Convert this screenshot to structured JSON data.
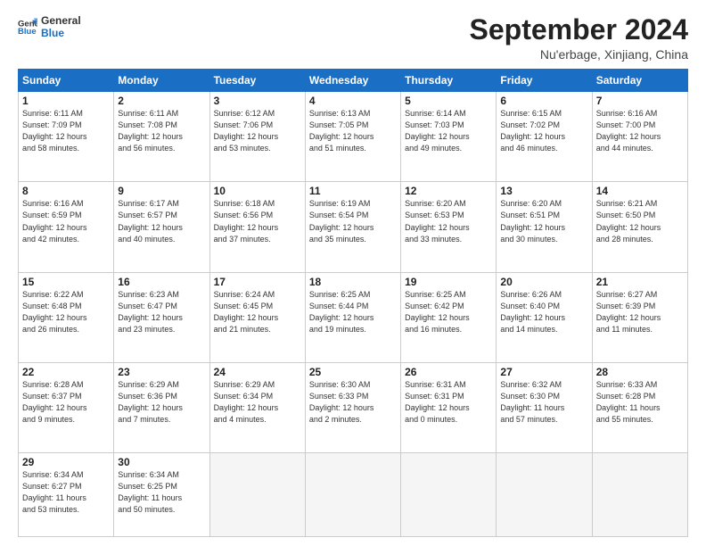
{
  "logo": {
    "line1": "General",
    "line2": "Blue"
  },
  "title": "September 2024",
  "location": "Nu'erbage, Xinjiang, China",
  "days_header": [
    "Sunday",
    "Monday",
    "Tuesday",
    "Wednesday",
    "Thursday",
    "Friday",
    "Saturday"
  ],
  "weeks": [
    [
      {
        "day": "1",
        "info": "Sunrise: 6:11 AM\nSunset: 7:09 PM\nDaylight: 12 hours\nand 58 minutes."
      },
      {
        "day": "2",
        "info": "Sunrise: 6:11 AM\nSunset: 7:08 PM\nDaylight: 12 hours\nand 56 minutes."
      },
      {
        "day": "3",
        "info": "Sunrise: 6:12 AM\nSunset: 7:06 PM\nDaylight: 12 hours\nand 53 minutes."
      },
      {
        "day": "4",
        "info": "Sunrise: 6:13 AM\nSunset: 7:05 PM\nDaylight: 12 hours\nand 51 minutes."
      },
      {
        "day": "5",
        "info": "Sunrise: 6:14 AM\nSunset: 7:03 PM\nDaylight: 12 hours\nand 49 minutes."
      },
      {
        "day": "6",
        "info": "Sunrise: 6:15 AM\nSunset: 7:02 PM\nDaylight: 12 hours\nand 46 minutes."
      },
      {
        "day": "7",
        "info": "Sunrise: 6:16 AM\nSunset: 7:00 PM\nDaylight: 12 hours\nand 44 minutes."
      }
    ],
    [
      {
        "day": "8",
        "info": "Sunrise: 6:16 AM\nSunset: 6:59 PM\nDaylight: 12 hours\nand 42 minutes."
      },
      {
        "day": "9",
        "info": "Sunrise: 6:17 AM\nSunset: 6:57 PM\nDaylight: 12 hours\nand 40 minutes."
      },
      {
        "day": "10",
        "info": "Sunrise: 6:18 AM\nSunset: 6:56 PM\nDaylight: 12 hours\nand 37 minutes."
      },
      {
        "day": "11",
        "info": "Sunrise: 6:19 AM\nSunset: 6:54 PM\nDaylight: 12 hours\nand 35 minutes."
      },
      {
        "day": "12",
        "info": "Sunrise: 6:20 AM\nSunset: 6:53 PM\nDaylight: 12 hours\nand 33 minutes."
      },
      {
        "day": "13",
        "info": "Sunrise: 6:20 AM\nSunset: 6:51 PM\nDaylight: 12 hours\nand 30 minutes."
      },
      {
        "day": "14",
        "info": "Sunrise: 6:21 AM\nSunset: 6:50 PM\nDaylight: 12 hours\nand 28 minutes."
      }
    ],
    [
      {
        "day": "15",
        "info": "Sunrise: 6:22 AM\nSunset: 6:48 PM\nDaylight: 12 hours\nand 26 minutes."
      },
      {
        "day": "16",
        "info": "Sunrise: 6:23 AM\nSunset: 6:47 PM\nDaylight: 12 hours\nand 23 minutes."
      },
      {
        "day": "17",
        "info": "Sunrise: 6:24 AM\nSunset: 6:45 PM\nDaylight: 12 hours\nand 21 minutes."
      },
      {
        "day": "18",
        "info": "Sunrise: 6:25 AM\nSunset: 6:44 PM\nDaylight: 12 hours\nand 19 minutes."
      },
      {
        "day": "19",
        "info": "Sunrise: 6:25 AM\nSunset: 6:42 PM\nDaylight: 12 hours\nand 16 minutes."
      },
      {
        "day": "20",
        "info": "Sunrise: 6:26 AM\nSunset: 6:40 PM\nDaylight: 12 hours\nand 14 minutes."
      },
      {
        "day": "21",
        "info": "Sunrise: 6:27 AM\nSunset: 6:39 PM\nDaylight: 12 hours\nand 11 minutes."
      }
    ],
    [
      {
        "day": "22",
        "info": "Sunrise: 6:28 AM\nSunset: 6:37 PM\nDaylight: 12 hours\nand 9 minutes."
      },
      {
        "day": "23",
        "info": "Sunrise: 6:29 AM\nSunset: 6:36 PM\nDaylight: 12 hours\nand 7 minutes."
      },
      {
        "day": "24",
        "info": "Sunrise: 6:29 AM\nSunset: 6:34 PM\nDaylight: 12 hours\nand 4 minutes."
      },
      {
        "day": "25",
        "info": "Sunrise: 6:30 AM\nSunset: 6:33 PM\nDaylight: 12 hours\nand 2 minutes."
      },
      {
        "day": "26",
        "info": "Sunrise: 6:31 AM\nSunset: 6:31 PM\nDaylight: 12 hours\nand 0 minutes."
      },
      {
        "day": "27",
        "info": "Sunrise: 6:32 AM\nSunset: 6:30 PM\nDaylight: 11 hours\nand 57 minutes."
      },
      {
        "day": "28",
        "info": "Sunrise: 6:33 AM\nSunset: 6:28 PM\nDaylight: 11 hours\nand 55 minutes."
      }
    ],
    [
      {
        "day": "29",
        "info": "Sunrise: 6:34 AM\nSunset: 6:27 PM\nDaylight: 11 hours\nand 53 minutes."
      },
      {
        "day": "30",
        "info": "Sunrise: 6:34 AM\nSunset: 6:25 PM\nDaylight: 11 hours\nand 50 minutes."
      },
      {
        "day": "",
        "info": ""
      },
      {
        "day": "",
        "info": ""
      },
      {
        "day": "",
        "info": ""
      },
      {
        "day": "",
        "info": ""
      },
      {
        "day": "",
        "info": ""
      }
    ]
  ]
}
